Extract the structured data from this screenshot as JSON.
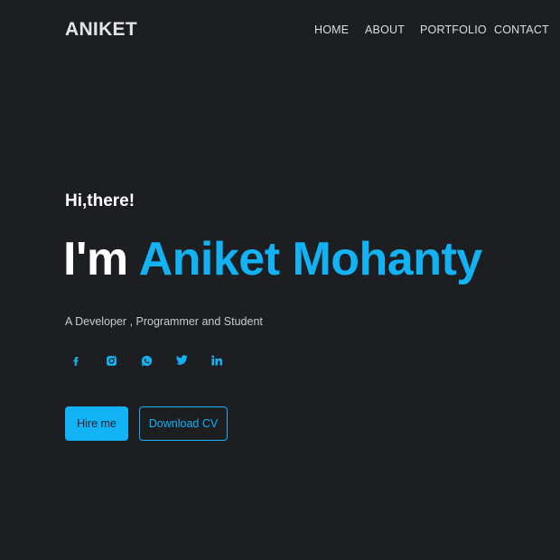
{
  "brand": {
    "logo": "ANIKET"
  },
  "nav": {
    "items": [
      {
        "label": "HOME"
      },
      {
        "label": "ABOUT"
      },
      {
        "label": "PORTFOLIO"
      },
      {
        "label": "CONTACT"
      }
    ]
  },
  "hero": {
    "greeting": "Hi,there!",
    "headline_prefix": "I'm",
    "headline_name": "Aniket Mohanty",
    "tagline": "A Developer , Programmer and Student"
  },
  "socials": [
    {
      "icon": "facebook-icon"
    },
    {
      "icon": "instagram-icon"
    },
    {
      "icon": "whatsapp-icon"
    },
    {
      "icon": "twitter-icon"
    },
    {
      "icon": "linkedin-icon"
    }
  ],
  "buttons": {
    "hire_label": "Hire me",
    "cv_label": "Download CV"
  },
  "colors": {
    "background": "#1c1e22",
    "accent": "#12b3f4",
    "text": "#ffffff",
    "muted_text": "#c9cacd"
  }
}
